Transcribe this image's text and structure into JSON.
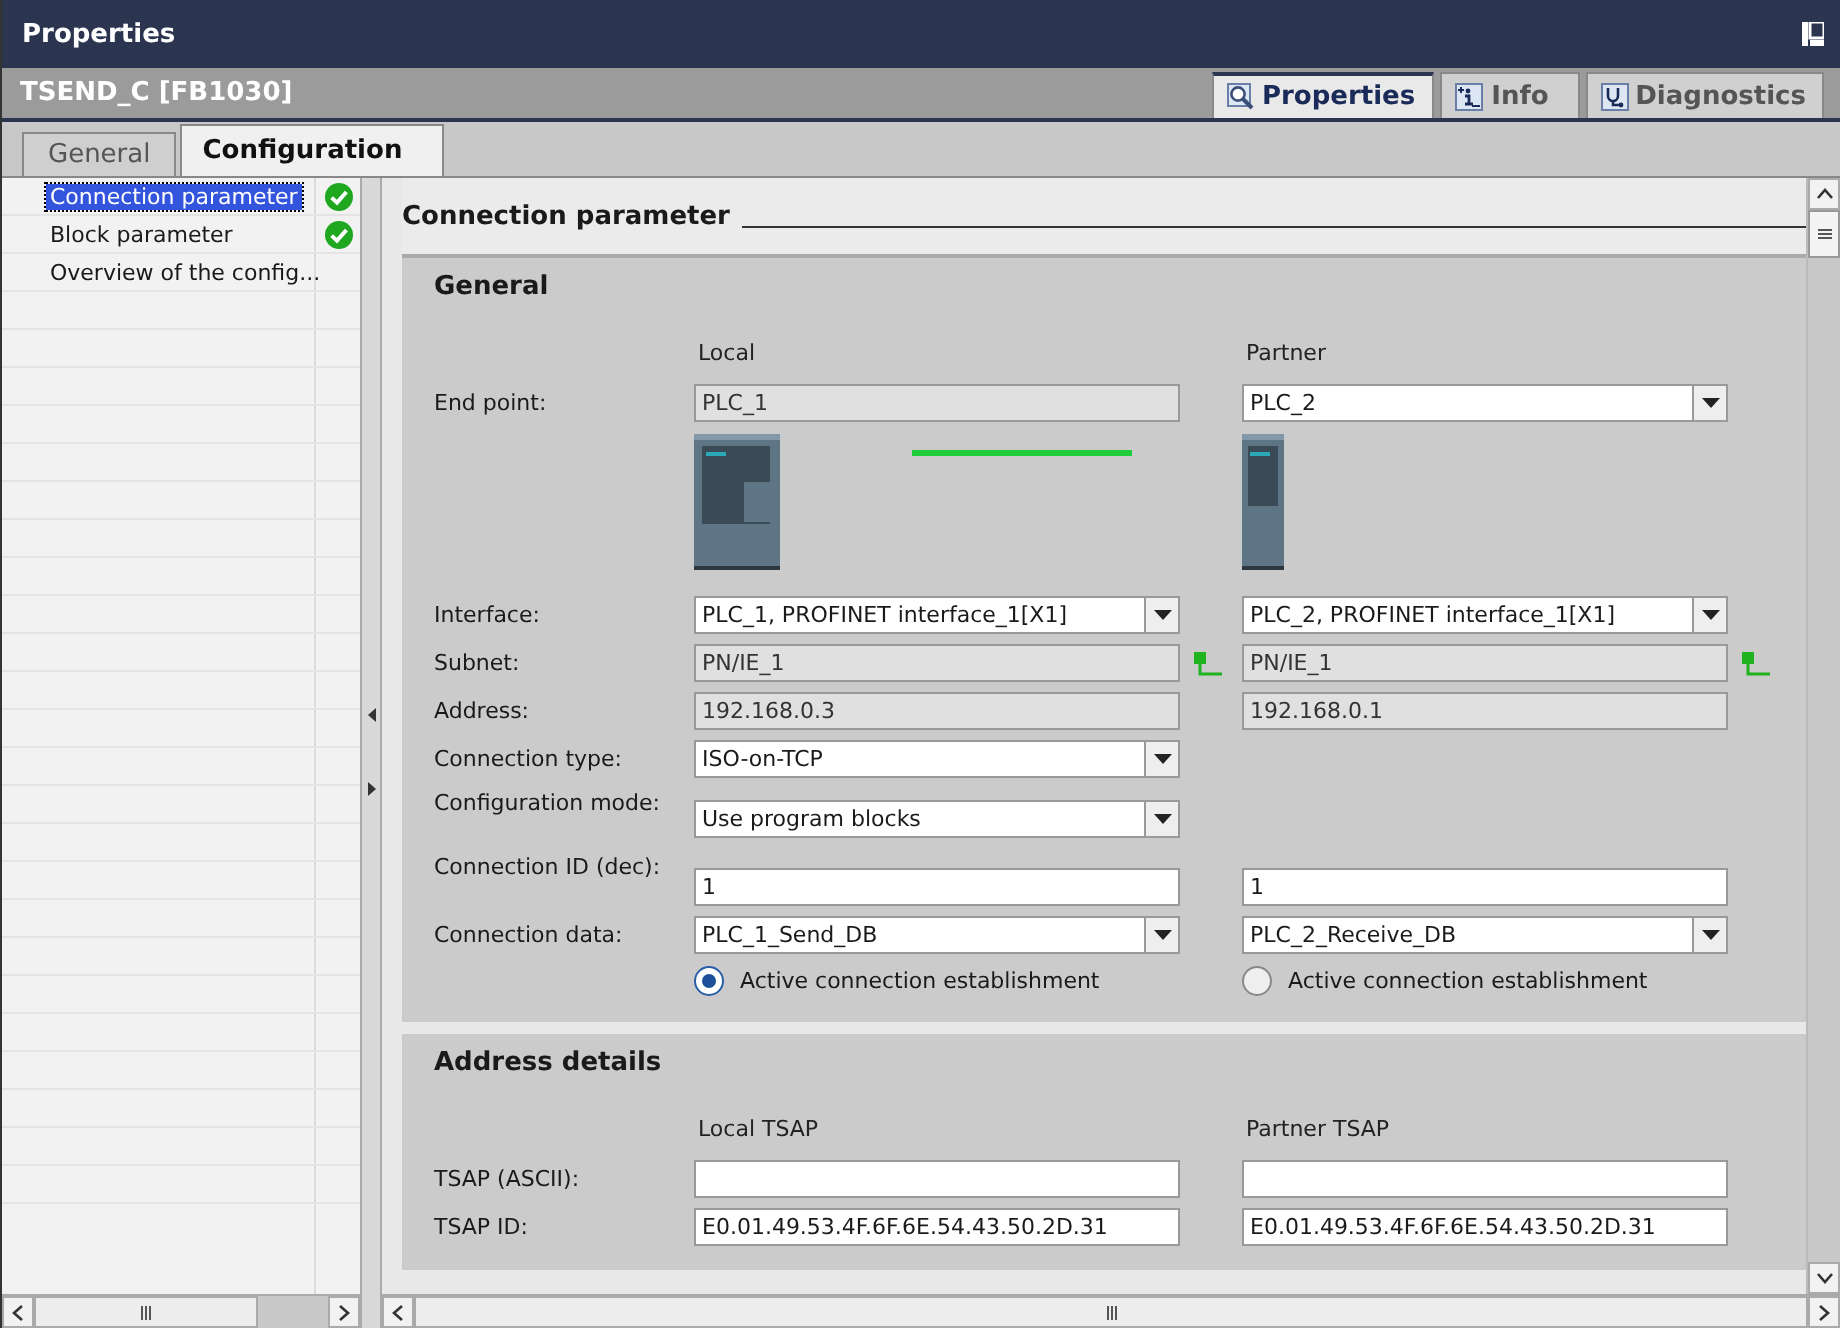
{
  "window": {
    "title": "Properties"
  },
  "object_title": "TSEND_C [FB1030]",
  "view_tabs": [
    {
      "label": "Properties",
      "selected": true
    },
    {
      "label": "Info",
      "selected": false
    },
    {
      "label": "Diagnostics",
      "selected": false
    }
  ],
  "tabs": [
    {
      "label": "General",
      "selected": false
    },
    {
      "label": "Configuration",
      "selected": true
    }
  ],
  "nav": {
    "items": [
      {
        "label": "Connection parameter",
        "selected": true,
        "complete": true
      },
      {
        "label": "Block parameter",
        "selected": false,
        "complete": true
      },
      {
        "label": "Overview of the config...",
        "selected": false,
        "complete": false
      }
    ]
  },
  "section": {
    "title": "Connection parameter",
    "general": {
      "title": "General",
      "columns": [
        "Local",
        "Partner"
      ],
      "rows": [
        {
          "kind": "field",
          "label": "End point:",
          "local": {
            "kind": "readonly",
            "value": "PLC_1"
          },
          "partner": {
            "kind": "dropdown",
            "value": "PLC_2"
          }
        },
        {
          "kind": "devices",
          "connected": true
        },
        {
          "kind": "field",
          "label": "Interface:",
          "local": {
            "kind": "dropdown",
            "value": "PLC_1, PROFINET interface_1[X1]"
          },
          "partner": {
            "kind": "dropdown",
            "value": "PLC_2, PROFINET interface_1[X1]"
          }
        },
        {
          "kind": "field",
          "label": "Subnet:",
          "local": {
            "kind": "readonly",
            "value": "PN/IE_1",
            "network": true
          },
          "partner": {
            "kind": "readonly",
            "value": "PN/IE_1",
            "network": true
          }
        },
        {
          "kind": "field",
          "label": "Address:",
          "local": {
            "kind": "readonly",
            "value": "192.168.0.3"
          },
          "partner": {
            "kind": "readonly",
            "value": "192.168.0.1"
          }
        },
        {
          "kind": "field",
          "label": "Connection type:",
          "local": {
            "kind": "dropdown",
            "value": "ISO-on-TCP"
          }
        },
        {
          "kind": "field",
          "label": "Configuration mode:",
          "local": {
            "kind": "dropdown",
            "value": "Use program blocks"
          }
        },
        {
          "kind": "field",
          "label": "Connection ID (dec):",
          "local": {
            "kind": "input",
            "value": "1"
          },
          "partner": {
            "kind": "input",
            "value": "1"
          }
        },
        {
          "kind": "field",
          "label": "Connection data:",
          "local": {
            "kind": "dropdown",
            "value": "PLC_1_Send_DB"
          },
          "partner": {
            "kind": "dropdown",
            "value": "PLC_2_Receive_DB"
          }
        },
        {
          "kind": "radio",
          "local": {
            "kind": "radio",
            "label": "Active connection establishment",
            "selected": true
          },
          "partner": {
            "kind": "radio",
            "label": "Active connection establishment",
            "selected": false
          }
        }
      ]
    },
    "address_details": {
      "title": "Address details",
      "columns": [
        "Local TSAP",
        "Partner TSAP"
      ],
      "rows": [
        {
          "kind": "field",
          "label": "TSAP (ASCII):",
          "local": {
            "kind": "input"
          },
          "partner": {
            "kind": "input"
          }
        },
        {
          "kind": "field",
          "label": "TSAP ID:",
          "local": {
            "kind": "input",
            "value": "E0.01.49.53.4F.6F.6E.54.43.50.2D.31"
          },
          "partner": {
            "kind": "input",
            "value": "E0.01.49.53.4F.6F.6E.54.43.50.2D.31"
          }
        }
      ]
    }
  }
}
